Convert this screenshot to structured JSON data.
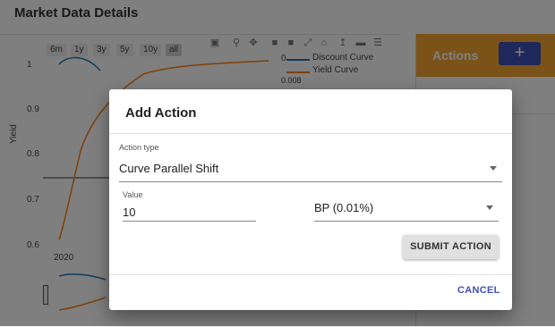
{
  "page": {
    "title": "Market Data Details"
  },
  "chart": {
    "range_buttons": [
      "6m",
      "1y",
      "3y",
      "5y",
      "10y",
      "all"
    ],
    "active_range": "all",
    "y_ticks": [
      "1",
      "0.9",
      "0.8",
      "0.7",
      "0.6"
    ],
    "y_title": "Yield",
    "x_tick": "2020",
    "legend": {
      "zero_label": "0",
      "small_value": "0.008",
      "series": [
        {
          "name": "Discount Curve",
          "color": "#1f77b4"
        },
        {
          "name": "Yield Curve",
          "color": "#ff7f0e"
        }
      ]
    },
    "modebar_icons": [
      "camera-icon",
      "zoom-icon",
      "pan-icon",
      "zoom-in-icon",
      "zoom-out-icon",
      "autoscale-icon",
      "home-icon",
      "spike-lines-icon",
      "hover-closest-icon",
      "hover-compare-icon"
    ]
  },
  "actions": {
    "title": "Actions",
    "add_label": "+",
    "accent_color": "#f6a531",
    "button_color": "#3f51b5"
  },
  "dialog": {
    "title": "Add Action",
    "action_type": {
      "label": "Action type",
      "value": "Curve Parallel Shift"
    },
    "value_field": {
      "label": "Value",
      "value": "10"
    },
    "unit_select": {
      "value": "BP (0.01%)"
    },
    "submit_label": "SUBMIT ACTION",
    "cancel_label": "CANCEL"
  }
}
